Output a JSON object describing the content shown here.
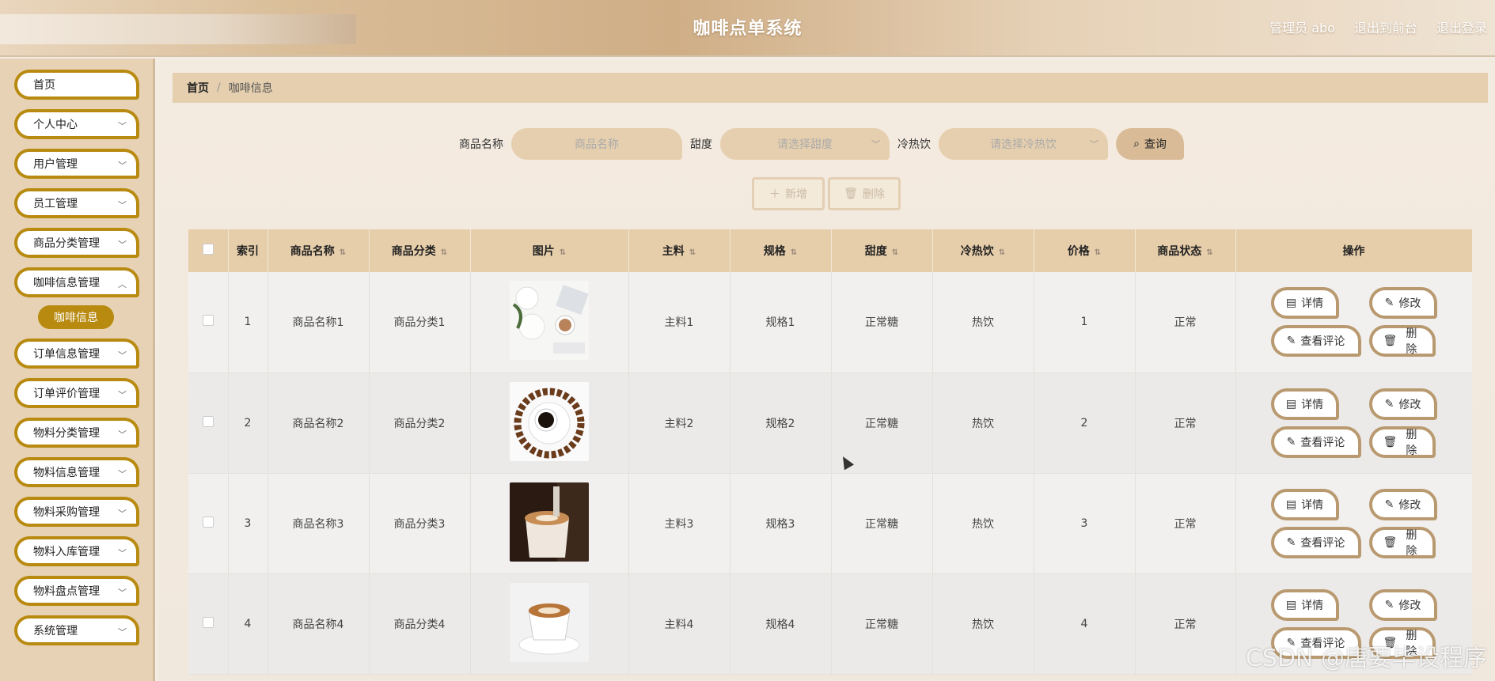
{
  "header": {
    "title": "咖啡点单系统",
    "admin": "管理员 abo",
    "to_front": "退出到前台",
    "logout": "退出登录"
  },
  "sidebar": {
    "items": [
      {
        "label": "首页",
        "chevron": false
      },
      {
        "label": "个人中心",
        "chevron": true
      },
      {
        "label": "用户管理",
        "chevron": true
      },
      {
        "label": "员工管理",
        "chevron": true
      },
      {
        "label": "商品分类管理",
        "chevron": true
      },
      {
        "label": "咖啡信息管理",
        "chevron": true
      },
      {
        "label": "订单信息管理",
        "chevron": true
      },
      {
        "label": "订单评价管理",
        "chevron": true
      },
      {
        "label": "物料分类管理",
        "chevron": true
      },
      {
        "label": "物料信息管理",
        "chevron": true
      },
      {
        "label": "物料采购管理",
        "chevron": true
      },
      {
        "label": "物料入库管理",
        "chevron": true
      },
      {
        "label": "物料盘点管理",
        "chevron": true
      },
      {
        "label": "系统管理",
        "chevron": true
      }
    ],
    "active_sub": "咖啡信息"
  },
  "breadcrumb": {
    "home": "首页",
    "sep": "/",
    "current": "咖啡信息"
  },
  "search": {
    "name_label": "商品名称",
    "name_placeholder": "商品名称",
    "sweet_label": "甜度",
    "sweet_placeholder": "请选择甜度",
    "temp_label": "冷热饮",
    "temp_placeholder": "请选择冷热饮",
    "query": "查询"
  },
  "actions": {
    "add": "新增",
    "delete": "删除"
  },
  "table": {
    "headers": [
      "索引",
      "商品名称",
      "商品分类",
      "图片",
      "主料",
      "规格",
      "甜度",
      "冷热饮",
      "价格",
      "商品状态",
      "操作"
    ],
    "rows": [
      {
        "index": "1",
        "name": "商品名称1",
        "category": "商品分类1",
        "main": "主料1",
        "spec": "规格1",
        "sweet": "正常糖",
        "temp": "热饮",
        "price": "1",
        "status": "正常"
      },
      {
        "index": "2",
        "name": "商品名称2",
        "category": "商品分类2",
        "main": "主料2",
        "spec": "规格2",
        "sweet": "正常糖",
        "temp": "热饮",
        "price": "2",
        "status": "正常"
      },
      {
        "index": "3",
        "name": "商品名称3",
        "category": "商品分类3",
        "main": "主料3",
        "spec": "规格3",
        "sweet": "正常糖",
        "temp": "热饮",
        "price": "3",
        "status": "正常"
      },
      {
        "index": "4",
        "name": "商品名称4",
        "category": "商品分类4",
        "main": "主料4",
        "spec": "规格4",
        "sweet": "正常糖",
        "temp": "热饮",
        "price": "4",
        "status": "正常"
      }
    ],
    "ops": {
      "detail": "详情",
      "edit": "修改",
      "comments": "查看评论",
      "delete": "删除"
    }
  },
  "watermark": "CSDN @唐要毕设程序",
  "colors": {
    "accent": "#b88a10",
    "header_bg": "#e7ceab"
  }
}
